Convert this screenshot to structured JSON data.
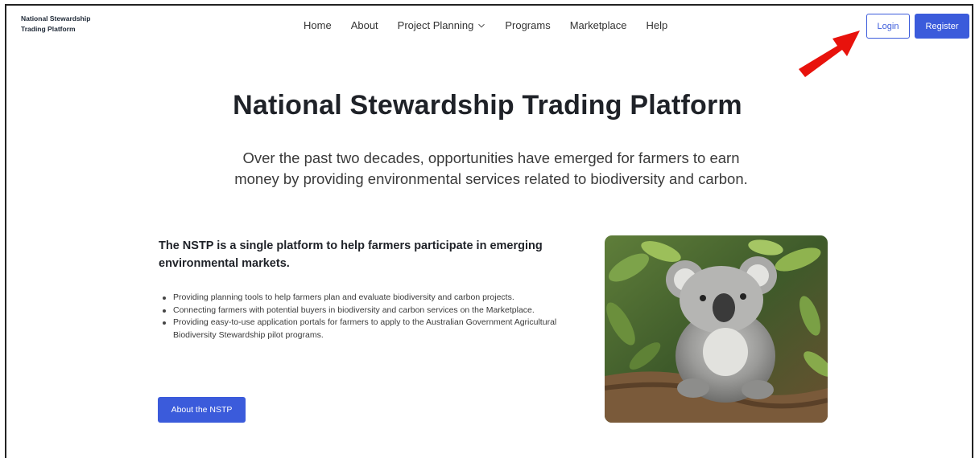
{
  "brand": {
    "line1": "National Stewardship",
    "line2": "Trading Platform"
  },
  "nav": {
    "items": [
      "Home",
      "About",
      "Project Planning",
      "Programs",
      "Marketplace",
      "Help"
    ]
  },
  "auth": {
    "login_label": "Login",
    "register_label": "Register"
  },
  "hero": {
    "title": "National Stewardship Trading Platform",
    "subtitle_line1": "Over the past two decades, opportunities have emerged for farmers to earn",
    "subtitle_line2": "money by providing environmental services related to biodiversity and carbon."
  },
  "intro": {
    "lead": "The NSTP is a single platform to help farmers participate in emerging environmental markets.",
    "bullets": [
      "Providing planning tools to help farmers plan and evaluate biodiversity and carbon projects.",
      "Connecting farmers with potential buyers in biodiversity and carbon services on the Marketplace.",
      "Providing easy-to-use application portals for farmers to apply to the Australian Government Agricultural Biodiversity Stewardship pilot programs."
    ],
    "about_button": "About the NSTP"
  },
  "colors": {
    "accent": "#3b5bdb",
    "annotation_arrow": "#e8120c"
  },
  "icons": {
    "project_planning_dropdown": "chevron-down-icon",
    "annotation": "red-arrow-icon"
  }
}
